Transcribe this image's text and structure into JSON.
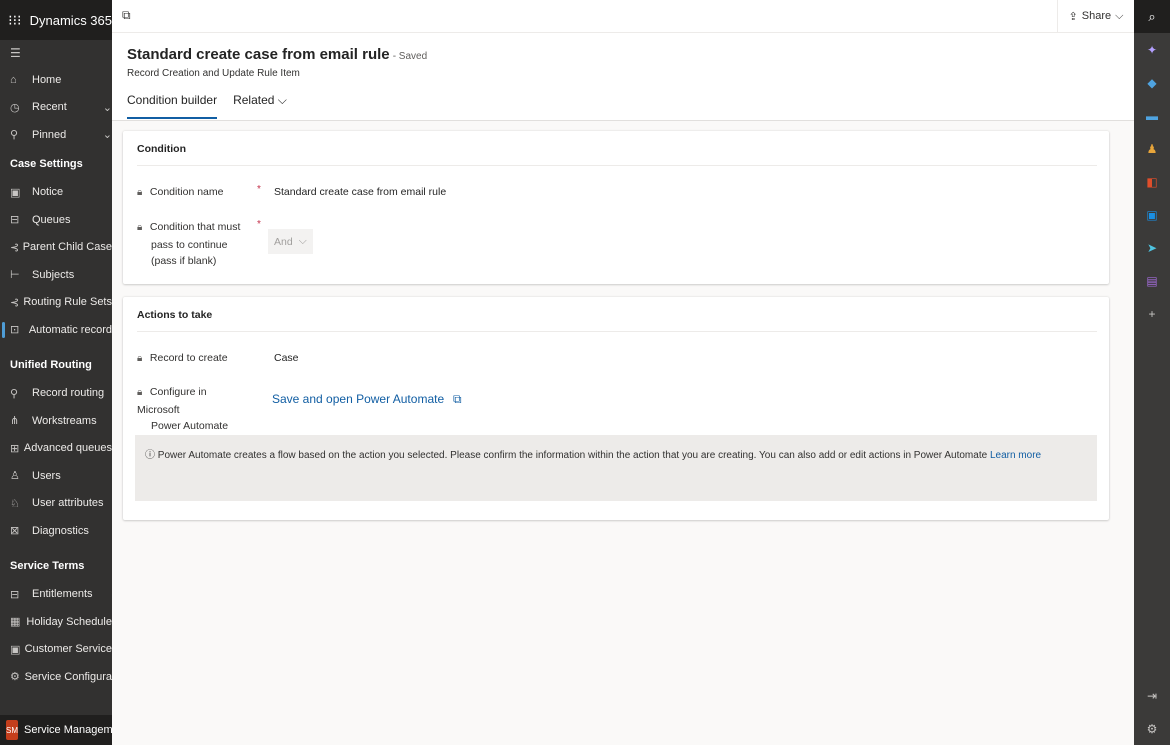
{
  "app": {
    "name": "Dynamics 365"
  },
  "nav": {
    "items": [
      {
        "icon": "home-icon",
        "glyph": "⌂",
        "label": "Home"
      },
      {
        "icon": "clock-icon",
        "glyph": "◷",
        "label": "Recent"
      },
      {
        "icon": "pin-icon",
        "glyph": "⚲",
        "label": "Pinned"
      }
    ],
    "groups": [
      {
        "title": "Case Settings",
        "items": [
          {
            "icon": "notice-icon",
            "glyph": "▣",
            "label": "Notice"
          },
          {
            "icon": "queues-icon",
            "glyph": "⊟",
            "label": "Queues"
          },
          {
            "icon": "parent-child-icon",
            "glyph": "⊰",
            "label": "Parent Child Case"
          },
          {
            "icon": "subjects-icon",
            "glyph": "⊢",
            "label": "Subjects"
          },
          {
            "icon": "routing-rule-icon",
            "glyph": "⊰",
            "label": "Routing Rule Sets"
          },
          {
            "icon": "automatic-record-icon",
            "glyph": "⊡",
            "label": "Automatic record"
          }
        ]
      },
      {
        "title": "Unified Routing",
        "items": [
          {
            "icon": "record-routing-icon",
            "glyph": "⚲",
            "label": "Record routing"
          },
          {
            "icon": "workstreams-icon",
            "glyph": "⋔",
            "label": "Workstreams"
          },
          {
            "icon": "advanced-queues-icon",
            "glyph": "⊞",
            "label": "Advanced queues"
          },
          {
            "icon": "user-icon",
            "glyph": "♙",
            "label": "Users"
          },
          {
            "icon": "user-attributes-icon",
            "glyph": "♘",
            "label": "User attributes"
          },
          {
            "icon": "diagnostics-icon",
            "glyph": "⊠",
            "label": "Diagnostics"
          }
        ]
      },
      {
        "title": "Service Terms",
        "items": [
          {
            "icon": "entitlements-icon",
            "glyph": "⊟",
            "label": "Entitlements"
          },
          {
            "icon": "calendar-icon",
            "glyph": "▦",
            "label": "Holiday Schedule"
          },
          {
            "icon": "customer-service-icon",
            "glyph": "▣",
            "label": "Customer Service"
          },
          {
            "icon": "service-config-icon",
            "glyph": "⚙",
            "label": "Service Configura"
          }
        ]
      }
    ],
    "area": {
      "initials": "SM",
      "label": "Service Managem"
    }
  },
  "cmdbar": {
    "share_label": "Share"
  },
  "record": {
    "title": "Standard create case from email rule",
    "status": "- Saved",
    "entity": "Record Creation and Update Rule Item"
  },
  "tabs": [
    {
      "label": "Condition builder",
      "selected": true
    },
    {
      "label": "Related",
      "selected": false
    }
  ],
  "condition": {
    "header": "Condition",
    "name_label": "Condition name",
    "name_value": "Standard create case from email rule",
    "must_label_1": "Condition that must",
    "must_label_2": "pass to continue",
    "must_label_3": "(pass if blank)",
    "operator": "And"
  },
  "actions": {
    "header": "Actions to take",
    "record_label": "Record to create",
    "record_value": "Case",
    "configure_label_1": "Configure in Microsoft",
    "configure_label_2": "Power Automate",
    "configure_link": "Save and open Power Automate",
    "info_text": "Power Automate creates a flow based on the action you selected. Please confirm the information within the action that you are creating. You can also add or edit actions in Power Automate",
    "learn_more": "Learn more"
  },
  "colors": {
    "accent": "#115ea3",
    "required": "#c4314b",
    "nav_bg": "#323130"
  }
}
